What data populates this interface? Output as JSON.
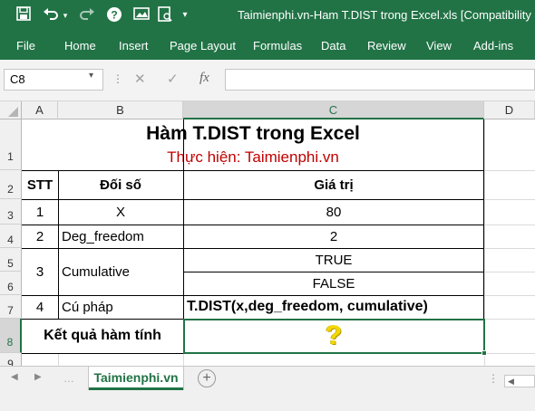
{
  "window": {
    "title": "Taimienphi.vn-Ham T.DIST trong Excel.xls  [Compatibility Mode]"
  },
  "ribbon": {
    "tabs": [
      "File",
      "Home",
      "Insert",
      "Page Layout",
      "Formulas",
      "Data",
      "Review",
      "View",
      "Add-ins"
    ]
  },
  "formula_bar": {
    "name_box": "C8",
    "cancel_icon": "✕",
    "enter_icon": "✓",
    "fx_label": "fx",
    "content": ""
  },
  "columns": [
    "A",
    "B",
    "C",
    "D"
  ],
  "selected_column": "C",
  "rows": [
    "1",
    "2",
    "3",
    "4",
    "5",
    "6",
    "7",
    "8",
    "9"
  ],
  "selected_row": "8",
  "sheet": {
    "title": "Hàm T.DIST trong Excel",
    "subtitle": "Thực hiện: Taimienphi.vn",
    "header": {
      "stt": "STT",
      "arg": "Đối số",
      "value": "Giá trị"
    },
    "r3": {
      "stt": "1",
      "arg": "X",
      "value": "80"
    },
    "r4": {
      "stt": "2",
      "arg": "Deg_freedom",
      "value": "2"
    },
    "r5": {
      "stt": "3",
      "arg": "Cumulative",
      "value_true": "TRUE",
      "value_false": "FALSE"
    },
    "r7": {
      "stt": "4",
      "arg": "Cú pháp",
      "value": "T.DIST(x,deg_freedom, cumulative)"
    },
    "r8": {
      "label": "Kết quả hàm tính",
      "value": "?"
    }
  },
  "sheet_tabs": [
    {
      "label": "Taimienphi.vn",
      "active": true
    }
  ],
  "colors": {
    "excel_green": "#217346",
    "subtitle_red": "#c00000",
    "question_yellow": "#f5d800"
  },
  "icons": [
    "save-icon",
    "undo-icon",
    "redo-icon",
    "help-icon",
    "image-icon",
    "print-preview-icon",
    "customize-icon",
    "sheet-prev-icon",
    "sheet-next-icon",
    "add-sheet-icon"
  ]
}
